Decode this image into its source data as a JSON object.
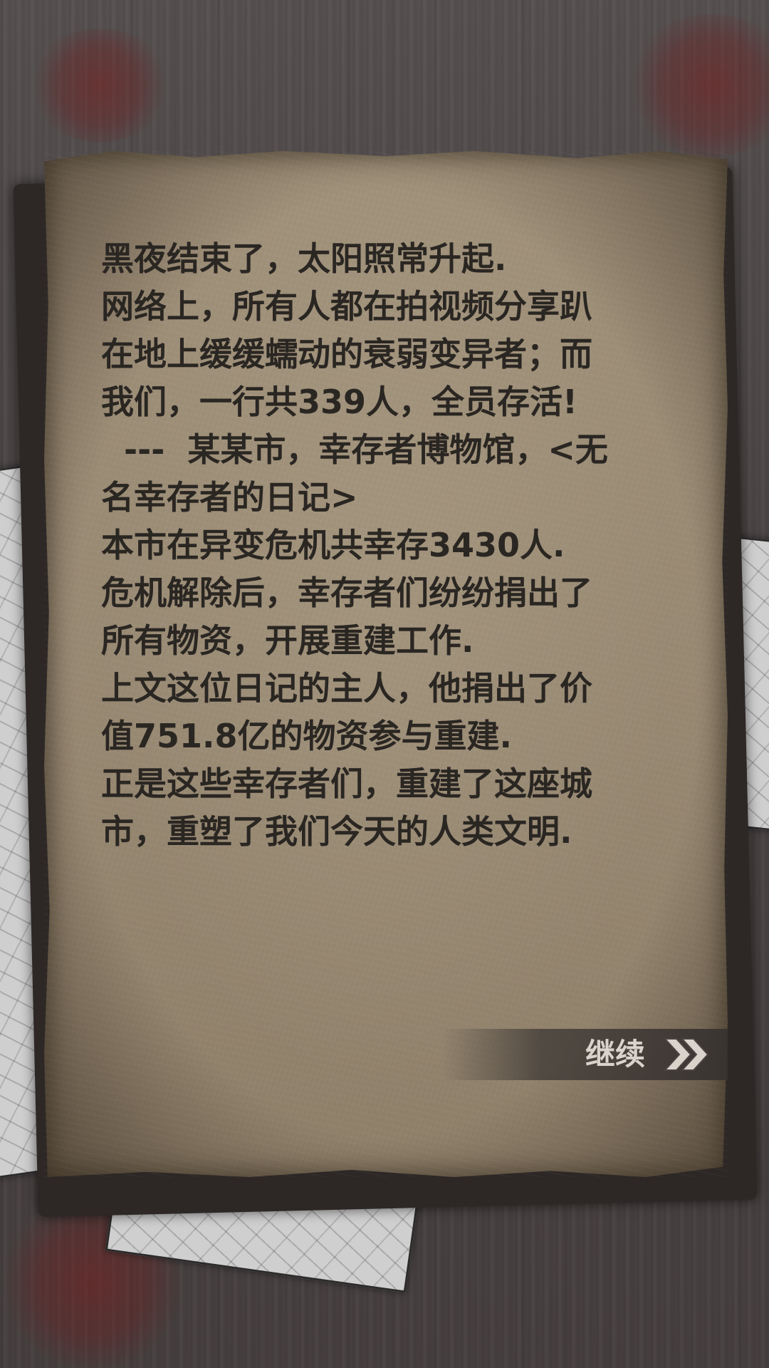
{
  "diary": {
    "lines": [
      "黑夜结束了，太阳照常升起.",
      "网络上，所有人都在拍视频分享趴",
      "在地上缓缓蠕动的衰弱变异者；而",
      "我们，一行共339人，全员存活!",
      "  ---  某某市，幸存者博物馆，<无",
      "名幸存者的日记>",
      "本市在异变危机共幸存3430人.",
      "危机解除后，幸存者们纷纷捐出了",
      "所有物资，开展重建工作.",
      "上文这位日记的主人，他捐出了价",
      "值751.8亿的物资参与重建.",
      "正是这些幸存者们，重建了这座城",
      "市，重塑了我们今天的人类文明."
    ]
  },
  "continue_button": {
    "label": "继续",
    "icon": "double-chevron-right-icon"
  },
  "colors": {
    "paper": "#988973",
    "text": "#2a2622",
    "wood": "#4b4545",
    "button_text": "#d9d3cc"
  }
}
